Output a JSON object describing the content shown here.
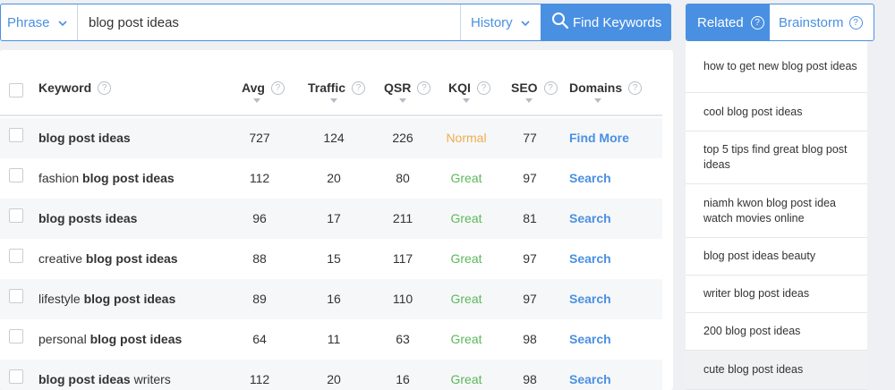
{
  "search": {
    "mode": "Phrase",
    "query": "blog post ideas",
    "history_label": "History",
    "find_label": "Find Keywords"
  },
  "table": {
    "headers": [
      "Keyword",
      "Avg",
      "Traffic",
      "QSR",
      "KQI",
      "SEO",
      "Domains"
    ],
    "rows": [
      {
        "pre": "",
        "bold": "blog post ideas",
        "post": "",
        "avg": "727",
        "traffic": "124",
        "qsr": "226",
        "kqi": "Normal",
        "seo": "77",
        "domains": "Find More"
      },
      {
        "pre": "fashion ",
        "bold": "blog post ideas",
        "post": "",
        "avg": "112",
        "traffic": "20",
        "qsr": "80",
        "kqi": "Great",
        "seo": "97",
        "domains": "Search"
      },
      {
        "pre": "",
        "bold": "blog posts ideas",
        "post": "",
        "avg": "96",
        "traffic": "17",
        "qsr": "211",
        "kqi": "Great",
        "seo": "81",
        "domains": "Search"
      },
      {
        "pre": "creative ",
        "bold": "blog post ideas",
        "post": "",
        "avg": "88",
        "traffic": "15",
        "qsr": "117",
        "kqi": "Great",
        "seo": "97",
        "domains": "Search"
      },
      {
        "pre": "lifestyle ",
        "bold": "blog post ideas",
        "post": "",
        "avg": "89",
        "traffic": "16",
        "qsr": "110",
        "kqi": "Great",
        "seo": "97",
        "domains": "Search"
      },
      {
        "pre": "personal ",
        "bold": "blog post ideas",
        "post": "",
        "avg": "64",
        "traffic": "11",
        "qsr": "63",
        "kqi": "Great",
        "seo": "98",
        "domains": "Search"
      },
      {
        "pre": "",
        "bold": "blog post ideas",
        "post": " writers",
        "avg": "112",
        "traffic": "20",
        "qsr": "16",
        "kqi": "Great",
        "seo": "98",
        "domains": "Search"
      }
    ]
  },
  "panel": {
    "tabs": [
      "Related",
      "Brainstorm"
    ],
    "items": [
      "how to get new blog post ideas",
      "cool blog post ideas",
      "top 5 tips find great blog post ideas",
      "niamh kwon blog post idea watch movies online",
      "blog post ideas beauty",
      "writer blog post ideas",
      "200 blog post ideas",
      "cute blog post ideas"
    ]
  },
  "colors": {
    "accent": "#4a90e2",
    "kqi_great": "#5cb85c",
    "kqi_normal": "#f0ad4e"
  },
  "icons": {
    "search": "magnifier-icon",
    "dropdown": "chevron-down-icon",
    "help": "help-circle-icon",
    "sort": "sort-caret-icon"
  }
}
